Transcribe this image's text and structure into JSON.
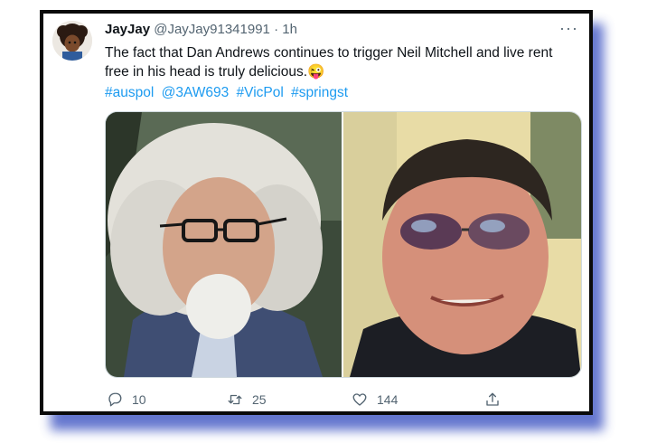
{
  "tweet": {
    "display_name": "JayJay",
    "handle": "@JayJay91341991",
    "separator": "·",
    "time": "1h",
    "more": "···",
    "text": "The fact that Dan Andrews continues to trigger Neil Mitchell and live rent free in his head is truly delicious.",
    "emoji": "😜",
    "hashtags": [
      "#auspol",
      "@3AW693",
      "#VicPol",
      "#springst"
    ]
  },
  "media": {
    "left_photo": "older-man-white-hair-glasses",
    "right_photo": "man-reflective-sunglasses"
  },
  "actions": {
    "reply_count": "10",
    "retweet_count": "25",
    "like_count": "144"
  },
  "colors": {
    "link": "#1d9bf0",
    "text": "#0f1419",
    "muted": "#536471",
    "frame": "#0a0a0a",
    "shadow": "#4a5fc6"
  }
}
